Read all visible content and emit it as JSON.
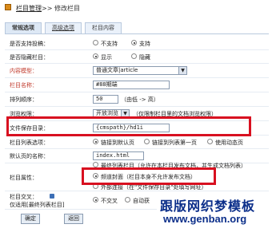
{
  "breadcrumb": {
    "link": "栏目管理",
    "separator": ">>",
    "current": "修改栏目"
  },
  "tabs": [
    "常规选项",
    "高级选项",
    "栏目内容"
  ],
  "form": {
    "allow_submit": {
      "label": "是否支持投稿：",
      "options": [
        "不支持",
        "支持"
      ],
      "selected": 1
    },
    "hidden": {
      "label": "是否隐藏栏目：",
      "options": [
        "显示",
        "隐藏"
      ],
      "selected": 0
    },
    "content_model": {
      "label": "内容模型：",
      "value": "普通文章|article"
    },
    "name": {
      "label": "栏目名称：",
      "value": "#88期端"
    },
    "sort": {
      "label": "排列顺序：",
      "value": "50",
      "hint": "（由低 -> 高）"
    },
    "browse": {
      "label": "浏览权限：",
      "value": "开放浏览",
      "hint": "（仅限制栏目里的文档浏览权限）"
    },
    "dir": {
      "label": "文件保存目录：",
      "value": "{cmspath}/hd1i"
    },
    "list_option": {
      "label": "栏目列表选项：",
      "options": [
        "链接到默认页",
        "链接到列表第一页",
        "使用动态页"
      ],
      "selected": 0
    },
    "default_page": {
      "label": "默认页的名称：",
      "value": "index.html"
    },
    "attr": {
      "label": "栏目属性：",
      "options": [
        "最终列表栏目（允许在本栏目发布文档，并生成文档列表）",
        "频道封面（栏目本身不允许发布文档）",
        "外部连接（在\"文件保存目录\"处填写网址）"
      ],
      "selected": 1
    },
    "cross": {
      "label": "栏目交叉：",
      "sublabel": "仅适用[最终列表栏目]",
      "options": [
        "不交叉",
        "自动获"
      ],
      "selected": 0
    }
  },
  "buttons": {
    "ok": "确定",
    "back": "返回"
  },
  "watermark": {
    "cn": "跟版网织梦模板",
    "url": "www.genban.org"
  }
}
